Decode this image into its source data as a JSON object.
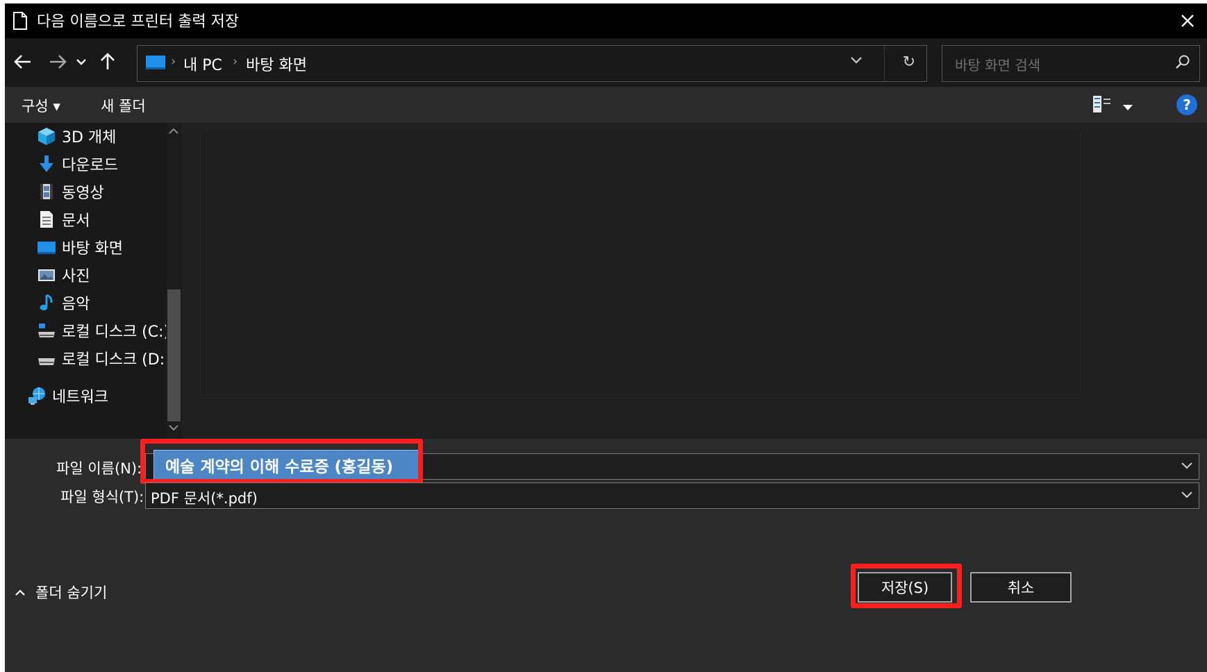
{
  "window": {
    "title": "다음 이름으로 프린터 출력 저장",
    "close_label": "✕"
  },
  "address_bar": {
    "breadcrumbs": [
      "내 PC",
      "바탕 화면"
    ],
    "separator": "›",
    "refresh_label": "↻"
  },
  "search": {
    "placeholder": "바탕 화면 검색"
  },
  "toolbar": {
    "organize_label": "구성 ▾",
    "new_folder_label": "새 폴더",
    "help_label": "?"
  },
  "nav_pane": {
    "items": [
      {
        "label": "3D 개체",
        "icon": "cube-icon"
      },
      {
        "label": "다운로드",
        "icon": "download-icon"
      },
      {
        "label": "동영상",
        "icon": "video-icon"
      },
      {
        "label": "문서",
        "icon": "document-icon"
      },
      {
        "label": "바탕 화면",
        "icon": "desktop-icon"
      },
      {
        "label": "사진",
        "icon": "picture-icon"
      },
      {
        "label": "음악",
        "icon": "music-icon"
      },
      {
        "label": "로컬 디스크 (C:)",
        "icon": "drive-c-icon"
      },
      {
        "label": "로컬 디스크 (D:)",
        "icon": "drive-icon"
      },
      {
        "label": "네트워크",
        "icon": "network-icon"
      }
    ]
  },
  "form": {
    "filename_label": "파일 이름(N):",
    "filename_value": "예술 계약의 이해 수료증 (홍길동)",
    "filetype_label": "파일 형식(T):",
    "filetype_value": "PDF 문서(*.pdf)"
  },
  "footer": {
    "hide_folders_label": "폴더 숨기기",
    "save_label": "저장(S)",
    "cancel_label": "취소"
  },
  "colors": {
    "highlight": "#ff1f1f",
    "selection": "#4d86c4",
    "accent": "#1e90e8"
  }
}
